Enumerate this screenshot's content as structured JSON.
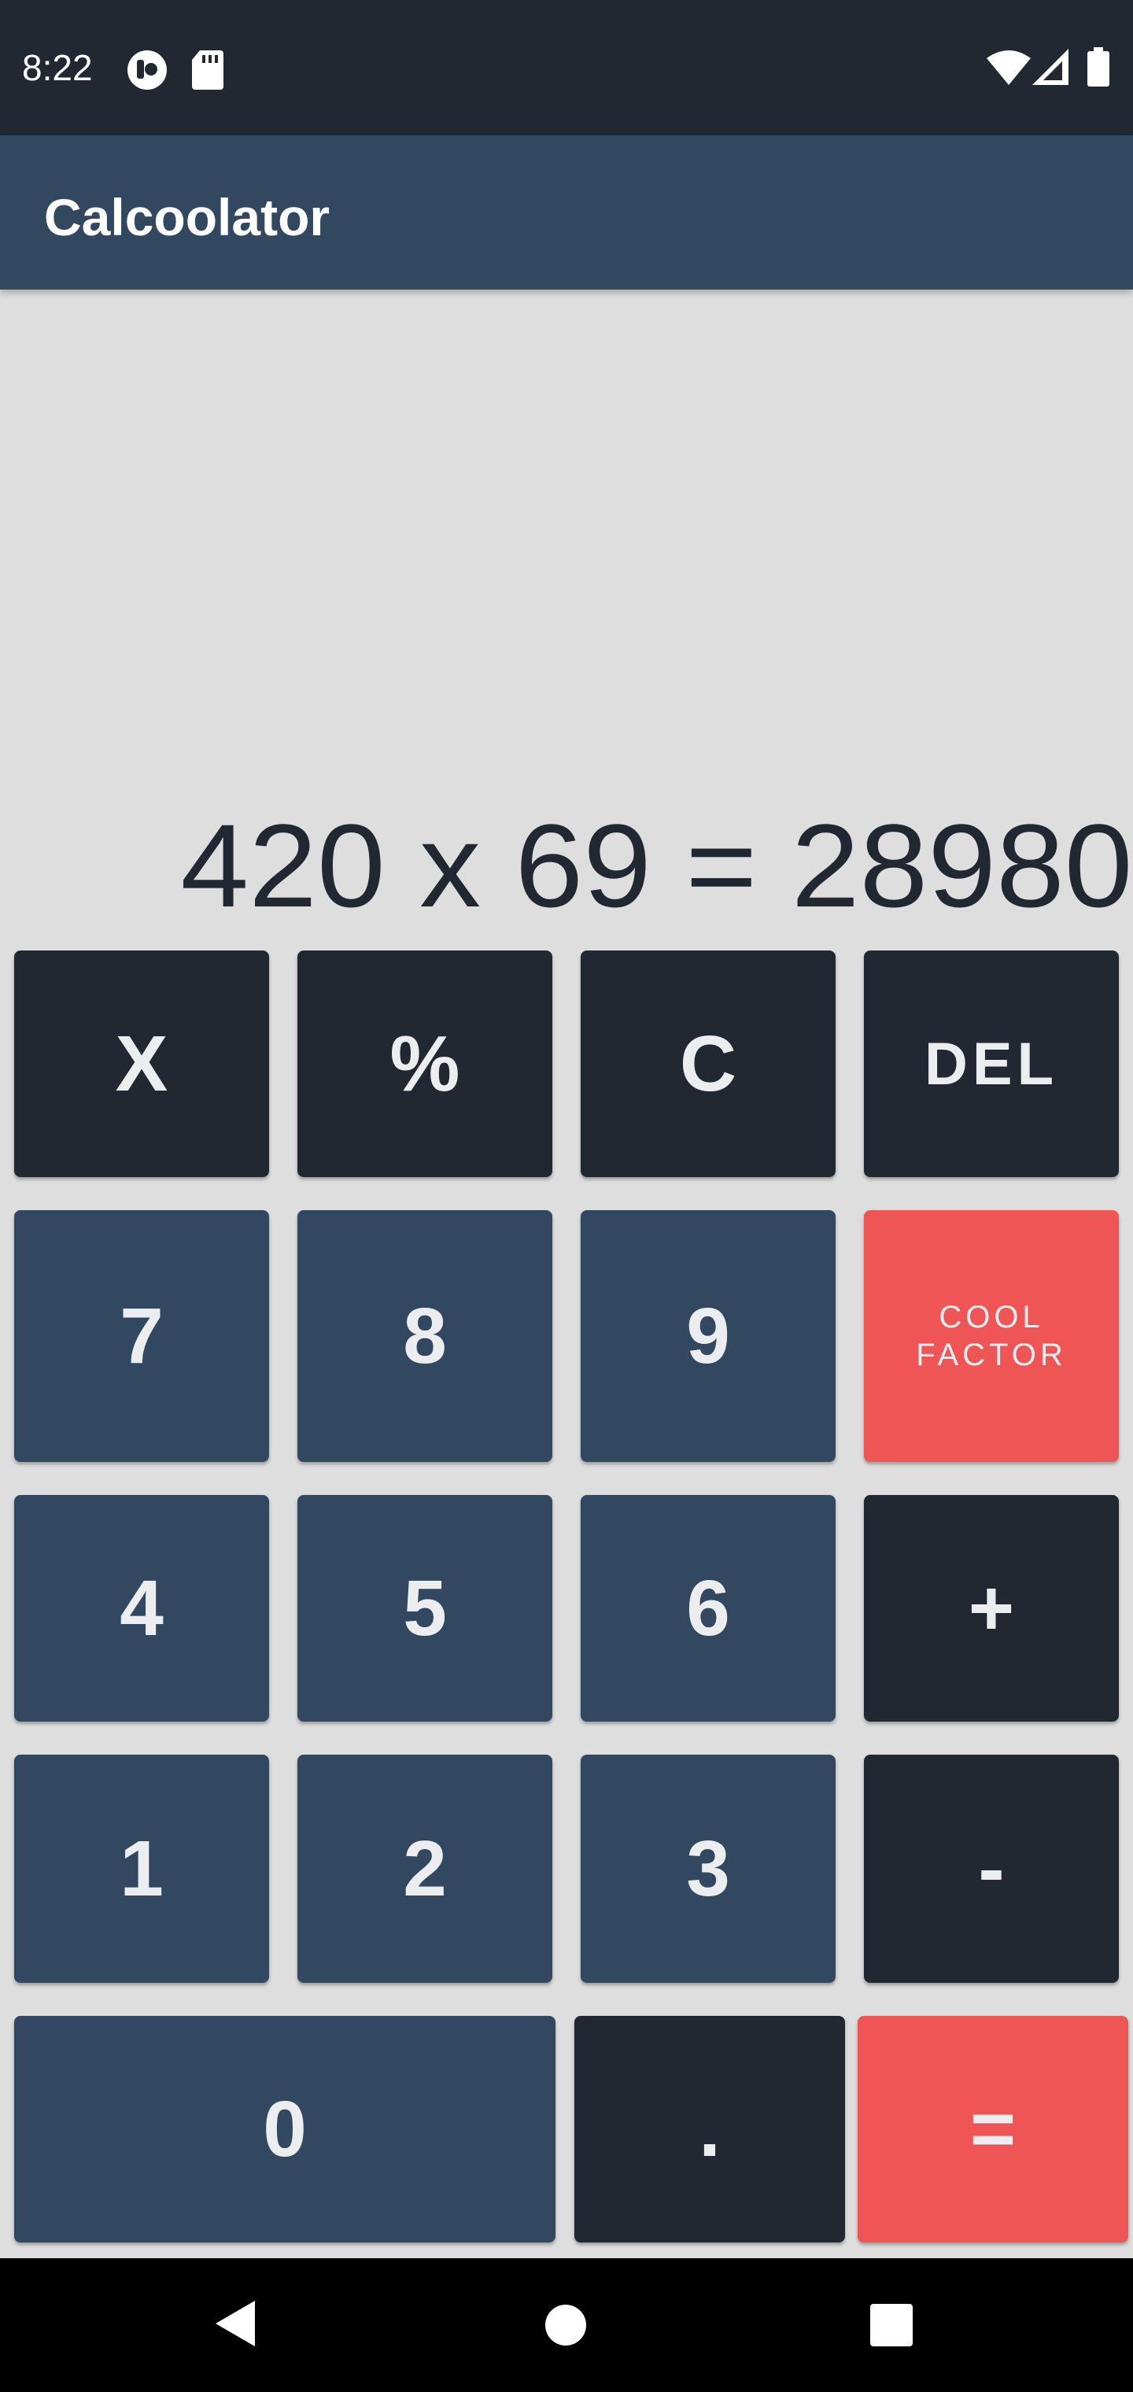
{
  "status_bar": {
    "time": "8:22",
    "icons": [
      "app-notification-icon",
      "sd-card-icon",
      "wifi-icon",
      "cellular-signal-icon",
      "battery-icon"
    ]
  },
  "app_bar": {
    "title": "Calcoolator"
  },
  "display": {
    "expression": "420 x 69 = 28980"
  },
  "keypad": {
    "multiply": "X",
    "percent": "%",
    "clear": "C",
    "delete": "DEL",
    "seven": "7",
    "eight": "8",
    "nine": "9",
    "cool_factor": "COOL FACTOR",
    "four": "4",
    "five": "5",
    "six": "6",
    "plus": "+",
    "one": "1",
    "two": "2",
    "three": "3",
    "minus": "-",
    "zero": "0",
    "decimal": ".",
    "equals": "="
  },
  "nav_bar": {
    "icons": [
      "back-icon",
      "home-icon",
      "recents-icon"
    ]
  },
  "colors": {
    "status_bar": "#222831",
    "app_bar": "#324760",
    "background": "#dedede",
    "key_dark": "#222831",
    "key_blue": "#324760",
    "key_red": "#f05556",
    "key_text": "#ebedef"
  }
}
